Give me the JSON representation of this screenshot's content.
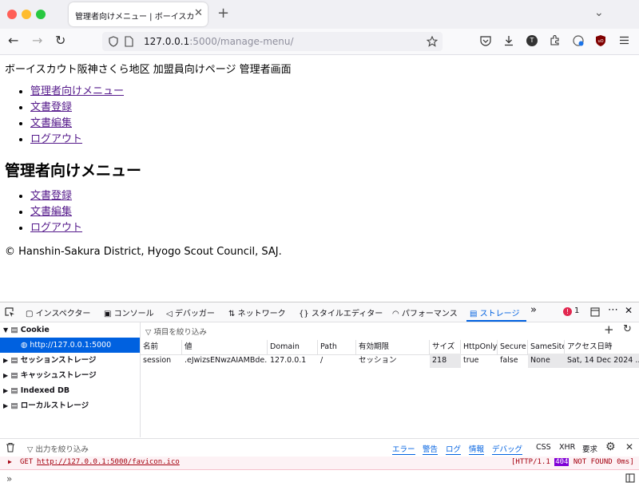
{
  "browser": {
    "tab_title": "管理者向けメニュー | ボーイスカウト阪",
    "tab_close": "✕",
    "new_tab": "+",
    "tab_list": "⌄",
    "url_host": "127.0.0.1",
    "url_rest": ":5000/manage-menu/",
    "icons": {
      "back": "←",
      "forward": "→",
      "reload": "↻"
    }
  },
  "page": {
    "header": "ボーイスカウト阪神さくら地区 加盟員向けページ 管理者画面",
    "nav_links": [
      "管理者向けメニュー",
      "文書登録",
      "文書編集",
      "ログアウト"
    ],
    "heading": "管理者向けメニュー",
    "menu_links": [
      "文書登録",
      "文書編集",
      "ログアウト"
    ],
    "footer": "© Hanshin-Sakura District, Hyogo Scout Council, SAJ."
  },
  "devtools": {
    "tabs": {
      "inspector": "インスペクター",
      "console": "コンソール",
      "debugger": "デバッガー",
      "network": "ネットワーク",
      "style": "スタイルエディター",
      "performance": "パフォーマンス",
      "storage": "ストレージ"
    },
    "error_count": "1",
    "sidebar": {
      "cookie": "Cookie",
      "cookie_host": "http://127.0.0.1:5000",
      "session_storage": "セッションストレージ",
      "cache_storage": "キャッシュストレージ",
      "indexed_db": "Indexed DB",
      "local_storage": "ローカルストレージ"
    },
    "filter_placeholder": "項目を絞り込み",
    "columns": [
      "名前",
      "値",
      "Domain",
      "Path",
      "有効期限",
      "サイズ",
      "HttpOnly",
      "Secure",
      "SameSite",
      "アクセス日時"
    ],
    "row": [
      "session",
      ".eJwizsENwzAIAMBde...",
      "127.0.0.1",
      "/",
      "セッション",
      "218",
      "true",
      "false",
      "None",
      "Sat, 14 Dec 2024 ..."
    ],
    "console": {
      "filter_placeholder": "出力を絞り込み",
      "levels": [
        "エラー",
        "警告",
        "ログ",
        "情報",
        "デバッグ"
      ],
      "types": [
        "CSS",
        "XHR",
        "要求"
      ],
      "method": "GET",
      "url": "http://127.0.0.1:5000/favicon.ico",
      "status_prefix": "[HTTP/1.1",
      "status_code": "404",
      "status_suffix": "NOT FOUND 0ms]",
      "prompt": "»"
    }
  },
  "colors": {
    "accent": "#0061e0",
    "link": "#551a8b",
    "error": "#a4000f"
  }
}
